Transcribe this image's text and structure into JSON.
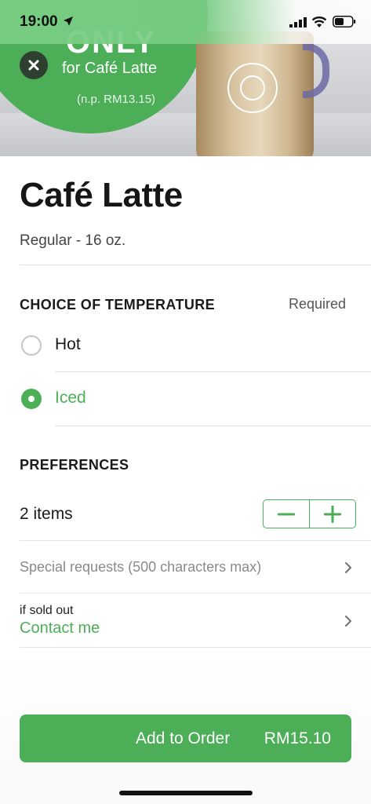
{
  "status_bar": {
    "time": "19:00"
  },
  "hero": {
    "promo_headline": "ONLY",
    "promo_subtitle": "for Café Latte",
    "promo_price_note": "(n.p. RM13.15)",
    "colors": {
      "promo_green": "#4caf58"
    }
  },
  "product": {
    "title": "Café Latte",
    "size": "Regular - 16 oz."
  },
  "temperature": {
    "section_title": "CHOICE OF TEMPERATURE",
    "required_label": "Required",
    "options": [
      {
        "label": "Hot",
        "selected": false
      },
      {
        "label": "Iced",
        "selected": true
      }
    ]
  },
  "preferences": {
    "section_title": "PREFERENCES",
    "quantity_label": "2 items",
    "special_requests": "Special requests (500 characters max)",
    "sold_out_label": "if sold out",
    "sold_out_value": "Contact me"
  },
  "footer": {
    "add_button_label": "Add to Order",
    "price": "RM15.10"
  },
  "icons": [
    "location-arrow-icon",
    "signal-icon",
    "wifi-icon",
    "battery-icon",
    "close-icon",
    "minus-icon",
    "plus-icon",
    "chevron-right-icon"
  ],
  "colors": {
    "accent": "#4caf58",
    "text": "#1a1a1a",
    "muted": "#8a8a8a"
  }
}
